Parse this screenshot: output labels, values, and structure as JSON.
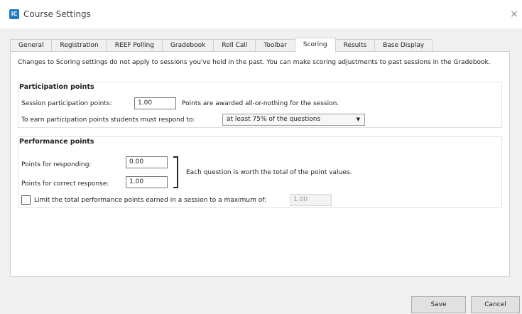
{
  "window": {
    "title": "Course Settings",
    "app_icon_text": "iC",
    "close_glyph": "×"
  },
  "tabs": [
    {
      "label": "General"
    },
    {
      "label": "Registration"
    },
    {
      "label": "REEF Polling"
    },
    {
      "label": "Gradebook"
    },
    {
      "label": "Roll Call"
    },
    {
      "label": "Toolbar"
    },
    {
      "label": "Scoring",
      "active": true
    },
    {
      "label": "Results"
    },
    {
      "label": "Base Display"
    }
  ],
  "notice": {
    "text": "Changes to Scoring settings do not apply to sessions you've held in the past. You can make scoring adjustments to past sessions in the Gradebook."
  },
  "participation": {
    "title": "Participation points",
    "session_label": "Session participation points:",
    "session_value": "1.00",
    "session_note": "Points are awarded all-or-nothing for the session.",
    "respond_label": "To earn participation points students must respond to:",
    "respond_selected": "at least 75% of the questions"
  },
  "performance": {
    "title": "Performance points",
    "responding_label": "Points for responding:",
    "responding_value": "0.00",
    "correct_label": "Points for correct response:",
    "correct_value": "1.00",
    "bracket_note": "Each question is worth the total of the point values.",
    "limit_label": "Limit the total performance points earned in a session to a maximum of:",
    "limit_checked": false,
    "limit_value": "1.00"
  },
  "footer": {
    "save_label": "Save",
    "cancel_label": "Cancel"
  }
}
